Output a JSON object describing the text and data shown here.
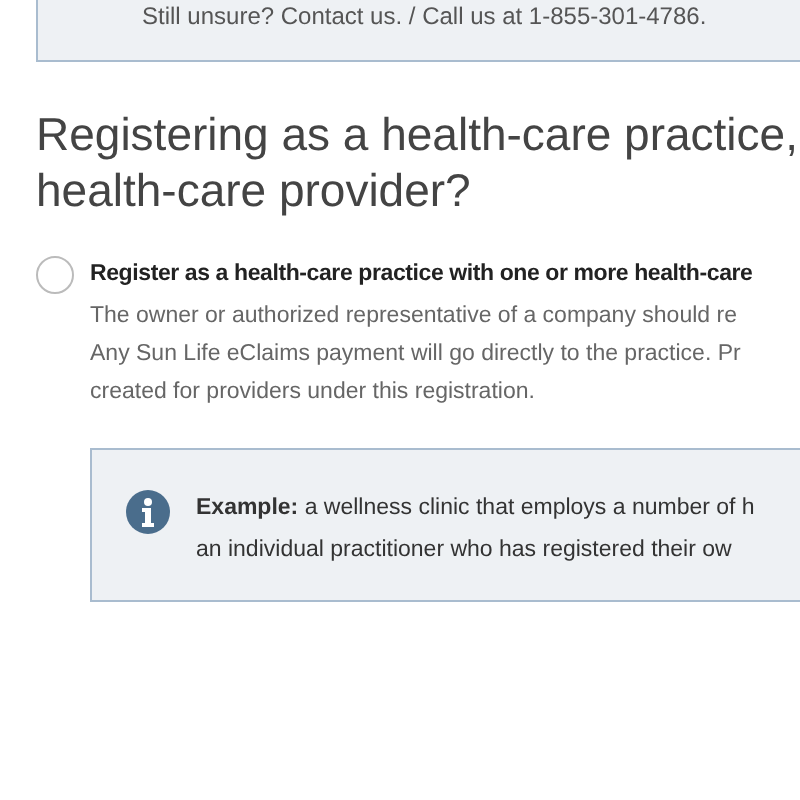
{
  "contact_banner": {
    "text": "Still unsure? Contact us. / Call us at 1-855-301-4786."
  },
  "heading_lines": [
    "Registering as a health-care practice,",
    "health-care provider?"
  ],
  "options": [
    {
      "label": "Register as a health-care practice with one or more health-care",
      "selected": false,
      "description_lines": [
        "The owner or authorized representative of a company should re",
        "Any Sun Life eClaims payment will go directly to the practice. Pr",
        "created for providers under this registration."
      ],
      "note": {
        "lines": [
          "**Example:** a wellness clinic that employs a number of h",
          "an individual practitioner who has registered their ow"
        ]
      }
    }
  ]
}
